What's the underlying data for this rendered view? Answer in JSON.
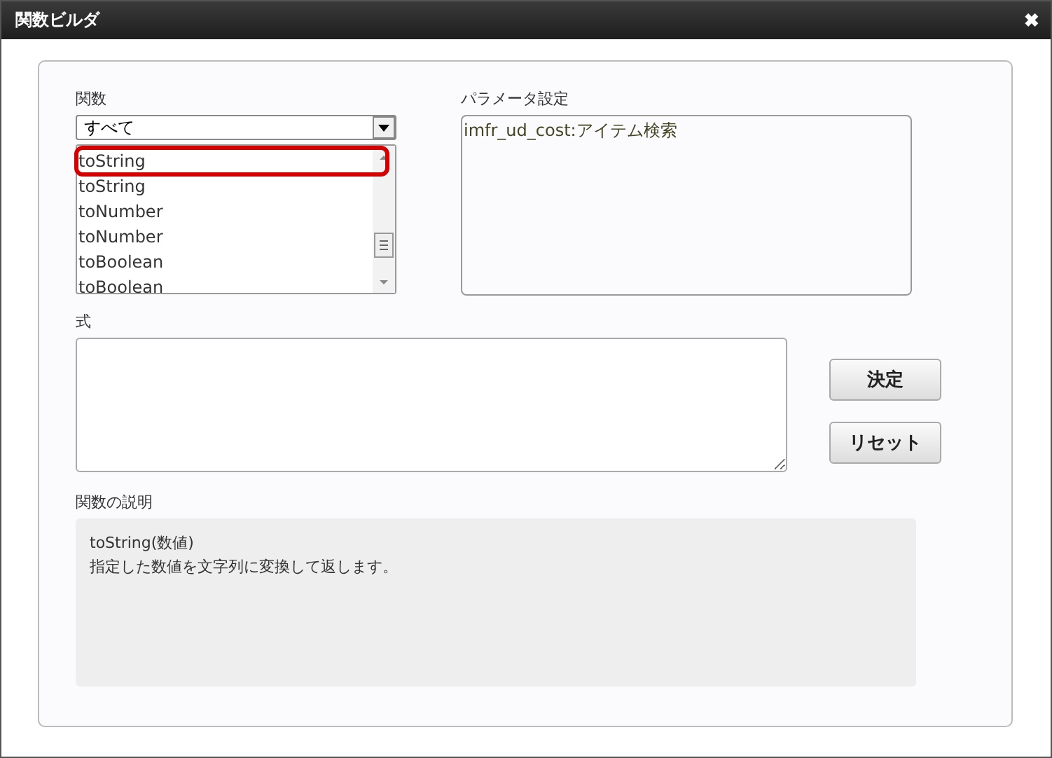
{
  "window": {
    "title": "関数ビルダ",
    "close": "✖"
  },
  "function": {
    "label": "関数",
    "category": "すべて",
    "items": [
      {
        "name": "toString",
        "highlighted": true
      },
      {
        "name": "toString",
        "highlighted": false
      },
      {
        "name": "toNumber",
        "highlighted": false
      },
      {
        "name": "toNumber",
        "highlighted": false
      },
      {
        "name": "toBoolean",
        "highlighted": false
      },
      {
        "name": "toBoolean",
        "highlighted": false
      }
    ]
  },
  "parameters": {
    "label": "パラメータ設定",
    "value": "imfr_ud_cost:アイテム検索"
  },
  "expression": {
    "label": "式"
  },
  "buttons": [
    "決定",
    "リセット"
  ],
  "description": {
    "label": "関数の説明",
    "signature": "toString(数値)",
    "text": "指定した数値を文字列に変換して返します。"
  }
}
